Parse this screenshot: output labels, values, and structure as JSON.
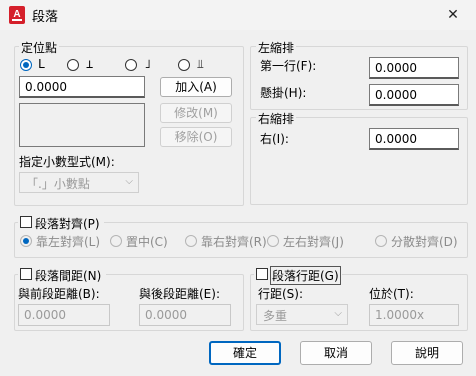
{
  "window": {
    "title": "段落",
    "close_glyph": "✕",
    "accent": "#0067c0",
    "app_icon_color": "#d5202b",
    "app_icon_letter": "A"
  },
  "tab_position": {
    "title": "定位點",
    "radios": [
      {
        "glyph": "L",
        "checked": true
      },
      {
        "glyph": "⊥",
        "checked": false
      },
      {
        "glyph": "˩",
        "checked": false
      },
      {
        "glyph": "⫫",
        "checked": false
      }
    ],
    "value": "0.0000",
    "add_button": "加入(A)",
    "modify_button": "修改(M)",
    "remove_button": "移除(O)",
    "decimal_label": "指定小數型式(M):",
    "decimal_value": "「.」小數點"
  },
  "left_indent": {
    "title": "左縮排",
    "first_line_label": "第一行(F):",
    "first_line_value": "0.0000",
    "hanging_label": "懸掛(H):",
    "hanging_value": "0.0000"
  },
  "right_indent": {
    "title": "右縮排",
    "right_label": "右(I):",
    "right_value": "0.0000"
  },
  "paragraph_alignment": {
    "label": "段落對齊(P)",
    "options": [
      "靠左對齊(L)",
      "置中(C)",
      "靠右對齊(R)",
      "左右對齊(J)",
      "分散對齊(D)"
    ]
  },
  "paragraph_spacing": {
    "label": "段落間距(N)",
    "before_label": "與前段距離(B):",
    "before_value": "0.0000",
    "after_label": "與後段距離(E):",
    "after_value": "0.0000"
  },
  "line_spacing": {
    "label": "段落行距(G)",
    "spacing_label": "行距(S):",
    "spacing_value": "多重",
    "at_label": "位於(T):",
    "at_value": "1.0000x"
  },
  "footer": {
    "ok": "確定",
    "cancel": "取消",
    "help": "說明"
  }
}
